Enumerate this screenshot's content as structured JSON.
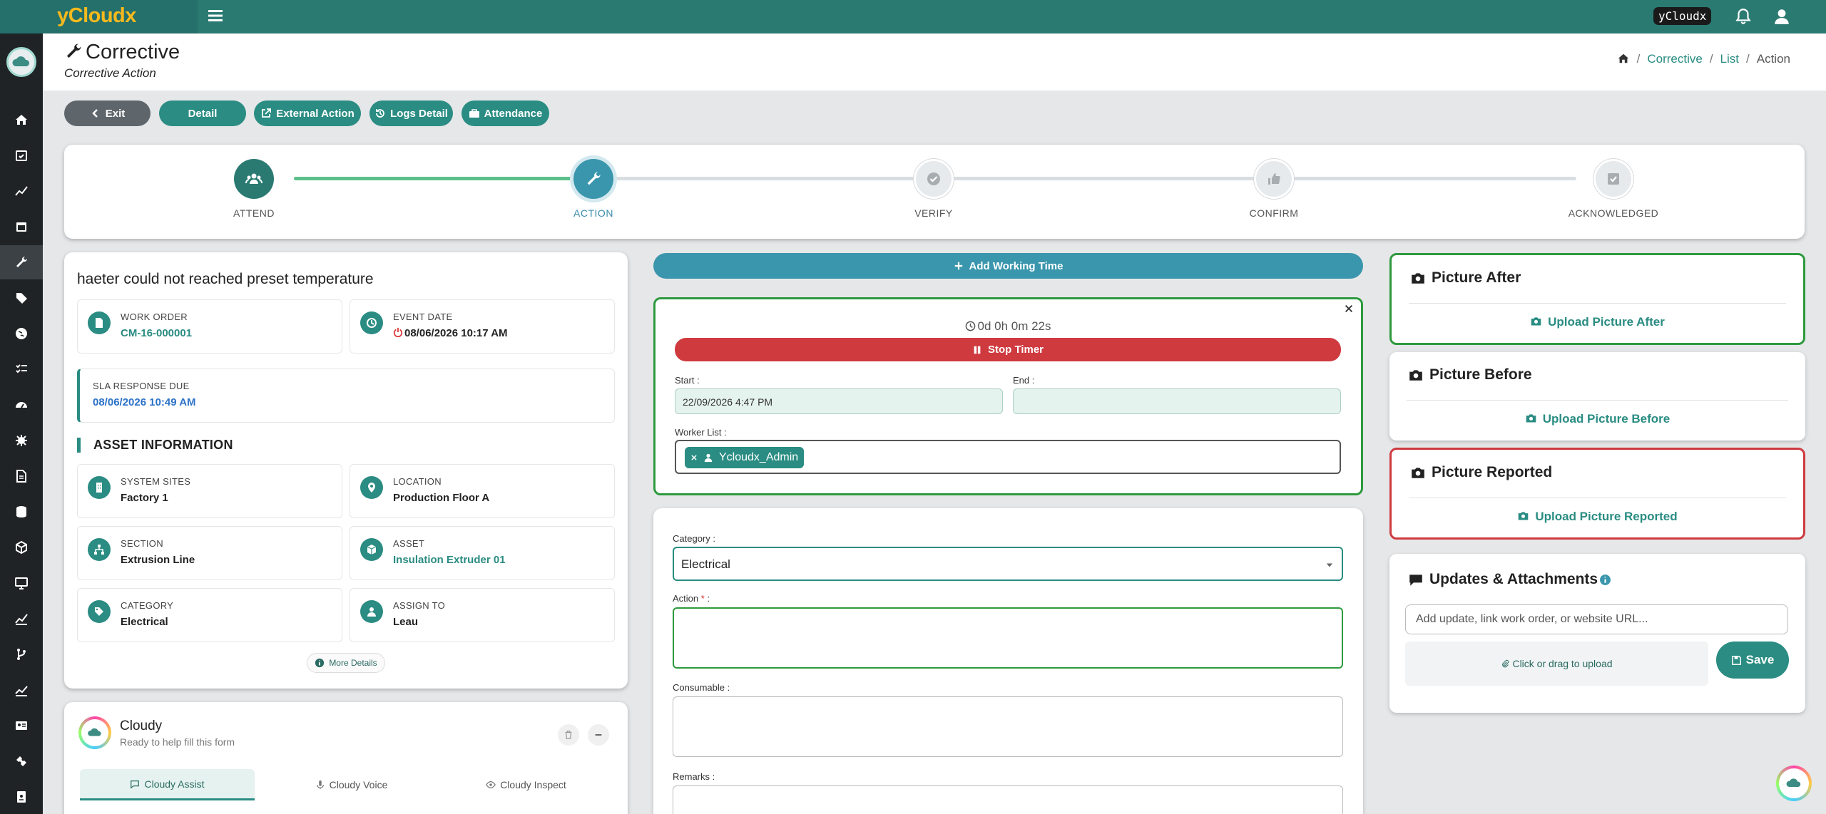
{
  "app": {
    "brand": "yCloudx",
    "user_tag": "yCloudx"
  },
  "page": {
    "title": "Corrective",
    "subtitle": "Corrective Action"
  },
  "breadcrumb": {
    "items": [
      "Corrective",
      "List",
      "Action"
    ]
  },
  "toolbar": {
    "exit": "Exit",
    "detail": "Detail",
    "external_action": "External Action",
    "logs_detail": "Logs Detail",
    "attendance": "Attendance"
  },
  "steps": [
    {
      "label": "ATTEND",
      "state": "done"
    },
    {
      "label": "ACTION",
      "state": "current"
    },
    {
      "label": "VERIFY",
      "state": "pending"
    },
    {
      "label": "CONFIRM",
      "state": "pending"
    },
    {
      "label": "ACKNOWLEDGED",
      "state": "pending"
    }
  ],
  "issue": {
    "title": "haeter could not reached preset temperature",
    "work_order_label": "WORK ORDER",
    "work_order": "CM-16-000001",
    "event_date_label": "EVENT DATE",
    "event_date": "08/06/2026 10:17 AM",
    "sla_label": "SLA RESPONSE DUE",
    "sla": "08/06/2026 10:49 AM"
  },
  "asset_info": {
    "heading": "ASSET INFORMATION",
    "system_sites_label": "SYSTEM SITES",
    "system_sites": "Factory 1",
    "location_label": "LOCATION",
    "location": "Production Floor A",
    "section_label": "SECTION",
    "section": "Extrusion Line",
    "asset_label": "ASSET",
    "asset": "Insulation Extruder 01",
    "category_label": "CATEGORY",
    "category": "Electrical",
    "assign_label": "ASSIGN TO",
    "assign": "Leau",
    "more": "More Details"
  },
  "cloudy": {
    "name": "Cloudy",
    "tagline": "Ready to help fill this form",
    "tabs": [
      "Cloudy Assist",
      "Cloudy Voice",
      "Cloudy Inspect"
    ]
  },
  "timer": {
    "add_working_time": "Add Working Time",
    "elapsed": "0d 0h 0m 22s",
    "stop": "Stop Timer",
    "start_label": "Start :",
    "start_value": "22/09/2026 4:47 PM",
    "end_label": "End :",
    "end_value": "",
    "worker_label": "Worker List :",
    "worker": "Ycloudx_Admin"
  },
  "form": {
    "category_label": "Category :",
    "category_value": "Electrical",
    "action_label": "Action",
    "required_mark": "*",
    "action_colon": " :",
    "consumable_label": "Consumable :",
    "remarks_label": "Remarks :"
  },
  "pictures": {
    "after_title": "Picture After",
    "after_upload": "Upload Picture After",
    "before_title": "Picture Before",
    "before_upload": "Upload Picture Before",
    "reported_title": "Picture Reported",
    "reported_upload": "Upload Picture Reported"
  },
  "updates": {
    "title": "Updates & Attachments",
    "placeholder": "Add update, link work order, or website URL...",
    "dropzone": "Click or drag to upload",
    "save": "Save"
  },
  "colors": {
    "primary": "#2a8c82",
    "danger": "#cf3a3f",
    "success": "#2e9a3e",
    "brand": "#f6b91e"
  }
}
